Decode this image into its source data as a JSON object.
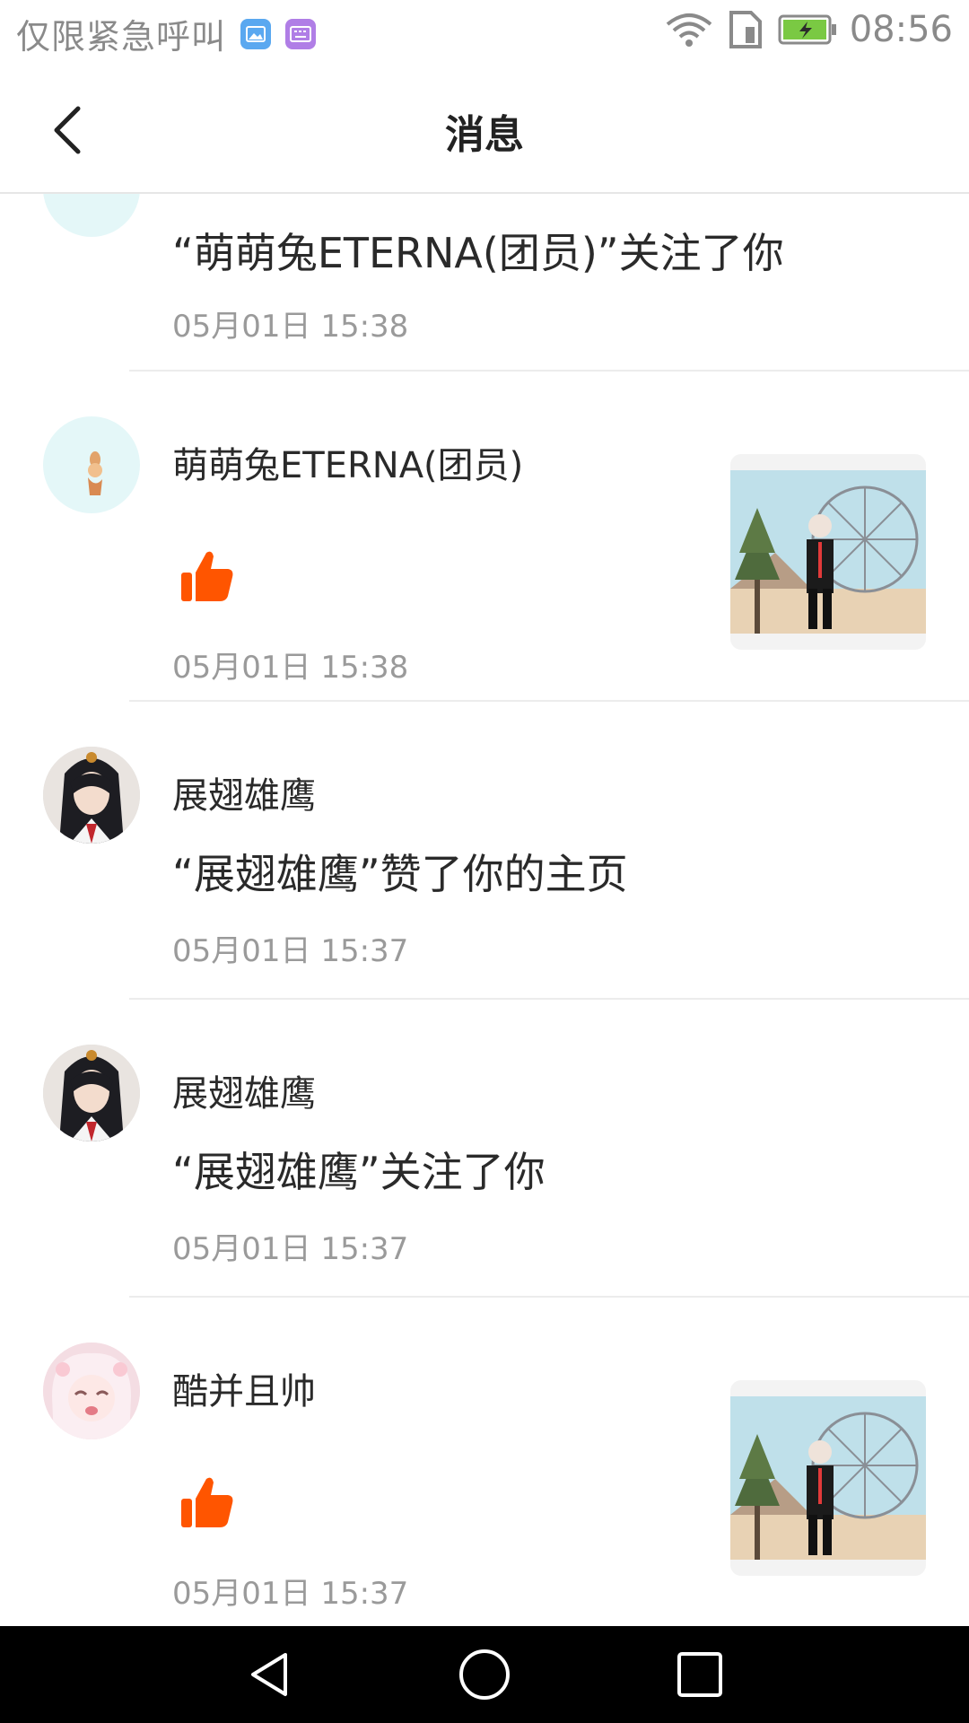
{
  "status_bar": {
    "carrier": "仅限紧急呼叫",
    "time": "08:56",
    "icons": [
      "gallery-icon",
      "keyboard-icon",
      "wifi-icon",
      "sim-icon",
      "battery-charging-icon"
    ]
  },
  "header": {
    "title": "消息",
    "back_icon": "chevron-left-icon"
  },
  "messages": [
    {
      "name": "",
      "content": "“萌萌兔ETERNA(团员)”关注了你",
      "time": "05月01日 15:38",
      "type": "follow"
    },
    {
      "name": "萌萌兔ETERNA(团员)",
      "content": "",
      "time": "05月01日 15:38",
      "type": "like-post",
      "icon": "thumbs-up-icon"
    },
    {
      "name": "展翅雄鹰",
      "content": "“展翅雄鹰”赞了你的主页",
      "time": "05月01日 15:37",
      "type": "like-profile"
    },
    {
      "name": "展翅雄鹰",
      "content": "“展翅雄鹰”关注了你",
      "time": "05月01日 15:37",
      "type": "follow"
    },
    {
      "name": "酷并且帅",
      "content": "",
      "time": "05月01日 15:37",
      "type": "like-post",
      "icon": "thumbs-up-icon"
    }
  ],
  "colors": {
    "like": "#ff5500",
    "text_primary": "#2a2a2a",
    "text_secondary": "#9a9a9a",
    "divider": "#ececec"
  },
  "navbar": {
    "icons": [
      "back-triangle-icon",
      "home-circle-icon",
      "recents-square-icon"
    ]
  }
}
